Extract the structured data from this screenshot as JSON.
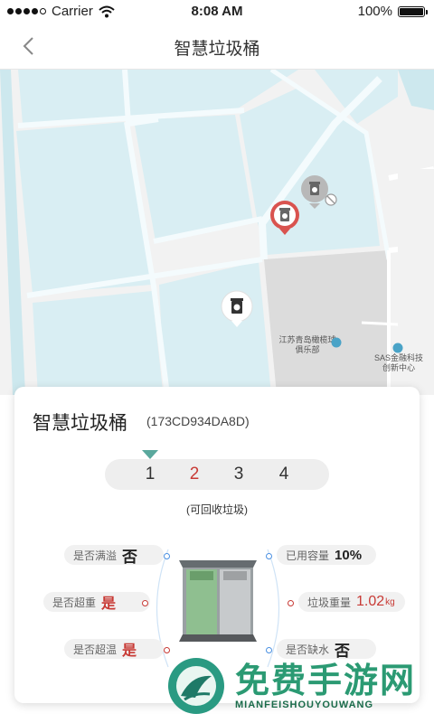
{
  "status_bar": {
    "carrier": "Carrier",
    "time": "8:08 AM",
    "battery": "100%"
  },
  "navbar": {
    "title": "智慧垃圾桶",
    "back_icon": "chevron-left-icon"
  },
  "map": {
    "labels": {
      "poi1": "江苏青岛橄榄球\n俱乐部",
      "poi2": "SAS金融科技\n创新中心"
    }
  },
  "panel": {
    "title": "智慧垃圾桶",
    "code": "(173CD934DA8D)",
    "tabs": [
      "1",
      "2",
      "3",
      "4"
    ],
    "active_tab": "2",
    "bin_type": "(可回收垃圾)",
    "left": [
      {
        "label": "是否满溢",
        "value": "否",
        "highlight": false
      },
      {
        "label": "是否超重",
        "value": "是",
        "highlight": true
      },
      {
        "label": "是否超温",
        "value": "是",
        "highlight": true
      }
    ],
    "right": [
      {
        "label": "已用容量",
        "value": "10%",
        "unit": "",
        "highlight": false
      },
      {
        "label": "垃圾重量",
        "value": "1.02",
        "unit": "kg",
        "highlight": true
      },
      {
        "label": "是否缺水",
        "value": "否",
        "unit": "",
        "highlight": false
      }
    ]
  },
  "watermark": {
    "title": "免费手游网",
    "subtitle": "MIANFEISHOUYOUWANG"
  },
  "colors": {
    "accent_red": "#c83a35",
    "teal": "#5aa89d",
    "water": "#d2ebf1",
    "land": "#e1f1f5"
  }
}
